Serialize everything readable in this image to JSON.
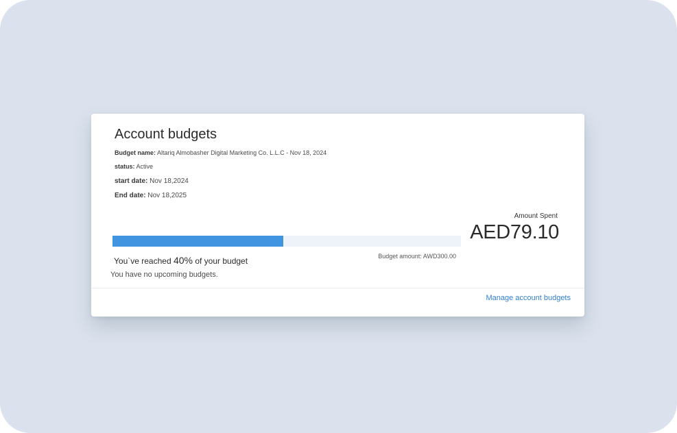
{
  "card": {
    "title": "Account budgets",
    "budget_name_label": "Budget name:",
    "budget_name_value": "Altariq Almobasher Digital Marketing Co. L.L.C - Nov 18, 2024",
    "status_label": "status:",
    "status_value": "Active",
    "start_label": "start date:",
    "start_value": "Nov 18,2024",
    "end_label": "End date:",
    "end_value": "Nov 18,2025"
  },
  "progress": {
    "fraction": 0.4895,
    "reached_prefix": "You`ve reached",
    "reached_pct": "40%",
    "reached_suffix": "of your budget",
    "budget_amount": "Budget amount: AWD300.00"
  },
  "spent": {
    "label": "Amount Spent",
    "value": "AED79.10"
  },
  "upcoming": "You have no upcoming budgets.",
  "footer": {
    "manage_link": "Manage account budgets"
  },
  "colors": {
    "accent": "#4194e0",
    "link": "#2f7fd1",
    "backdrop": "#dbe2ed"
  }
}
